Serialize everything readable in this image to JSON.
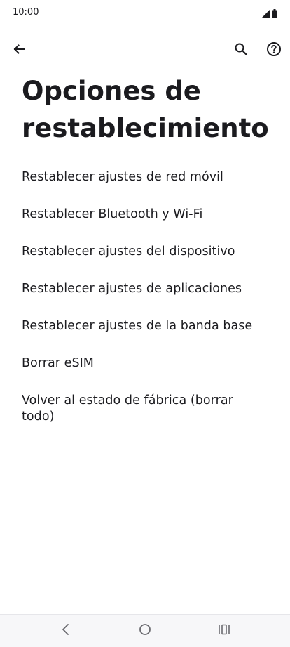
{
  "status_bar": {
    "time": "10:00",
    "icons": [
      "signal-icon",
      "battery-icon"
    ]
  },
  "top_bar": {
    "back_icon": "arrow-back-icon",
    "search_icon": "search-icon",
    "help_icon": "help-icon"
  },
  "page": {
    "title": "Opciones de restablecimiento"
  },
  "menu": {
    "items": [
      {
        "label": "Restablecer ajustes de red móvil"
      },
      {
        "label": "Restablecer Bluetooth y Wi-Fi"
      },
      {
        "label": "Restablecer ajustes del dispositivo"
      },
      {
        "label": "Restablecer ajustes de aplicaciones"
      },
      {
        "label": "Restablecer ajustes de la banda base"
      },
      {
        "label": "Borrar eSIM"
      },
      {
        "label": "Volver al estado de fábrica (borrar todo)"
      }
    ]
  },
  "nav_bar": {
    "icons": [
      "nav-back-icon",
      "nav-home-icon",
      "nav-recents-icon"
    ]
  },
  "colors": {
    "text": "#1b1b1f",
    "background": "#ffffff",
    "nav_background": "#f7f7f9"
  }
}
